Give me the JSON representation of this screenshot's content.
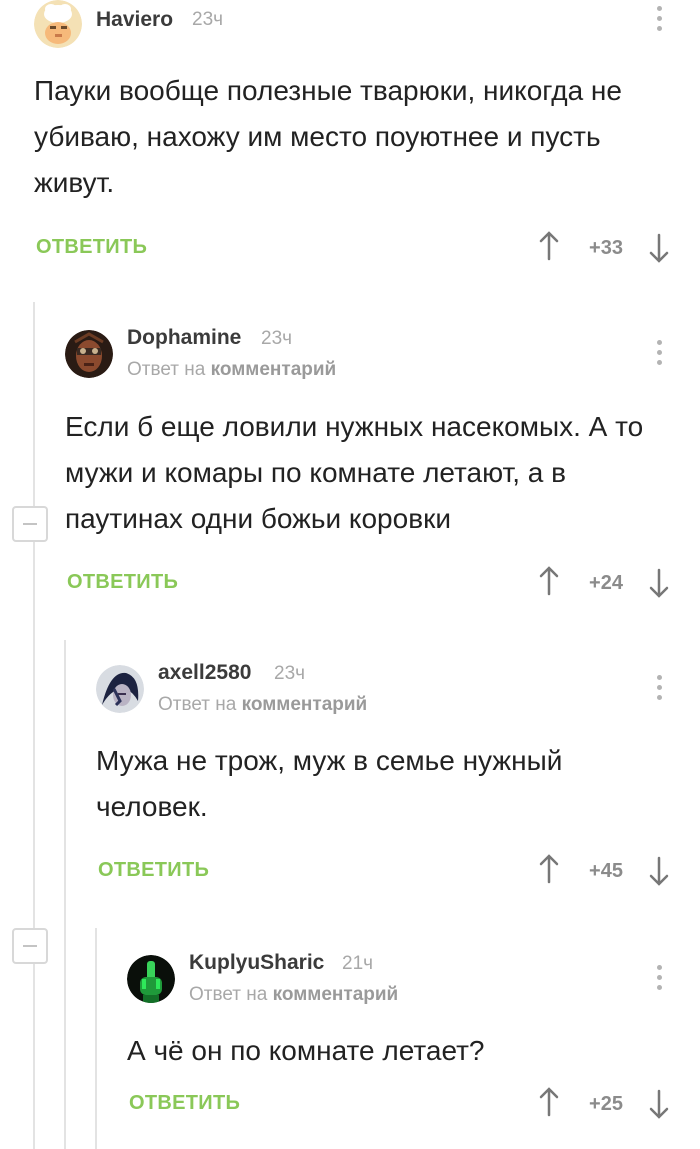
{
  "comments": [
    {
      "author": "Haviero",
      "time": "23ч",
      "reply_prefix": "",
      "reply_link": "",
      "text": "Пауки вообще полезные тварюки, никогда не убиваю, нахожу им место поуютнее и пусть живут.",
      "reply_label": "ОТВЕТИТЬ",
      "rating": "+33"
    },
    {
      "author": "Dophamine",
      "time": "23ч",
      "reply_prefix": "Ответ на",
      "reply_link": "комментарий",
      "text": "Если б еще ловили нужных насекомых. А то мужи и комары по комнате летают, а в паутинах одни божьи коровки",
      "reply_label": "ОТВЕТИТЬ",
      "rating": "+24"
    },
    {
      "author": "axell2580",
      "time": "23ч",
      "reply_prefix": "Ответ на",
      "reply_link": "комментарий",
      "text": "Мужа не трож, муж в семье нужный человек.",
      "reply_label": "ОТВЕТИТЬ",
      "rating": "+45"
    },
    {
      "author": "KuplyuSharic",
      "time": "21ч",
      "reply_prefix": "Ответ на",
      "reply_link": "комментарий",
      "text": "А чё он по комнате летает?",
      "reply_label": "ОТВЕТИТЬ",
      "rating": "+25"
    }
  ],
  "colors": {
    "accent": "#8ac858",
    "muted": "#a8a8a8",
    "text": "#222222"
  },
  "icons": [
    "avatar",
    "more-vertical-icon",
    "arrow-up-icon",
    "arrow-down-icon",
    "collapse-minus-icon"
  ]
}
